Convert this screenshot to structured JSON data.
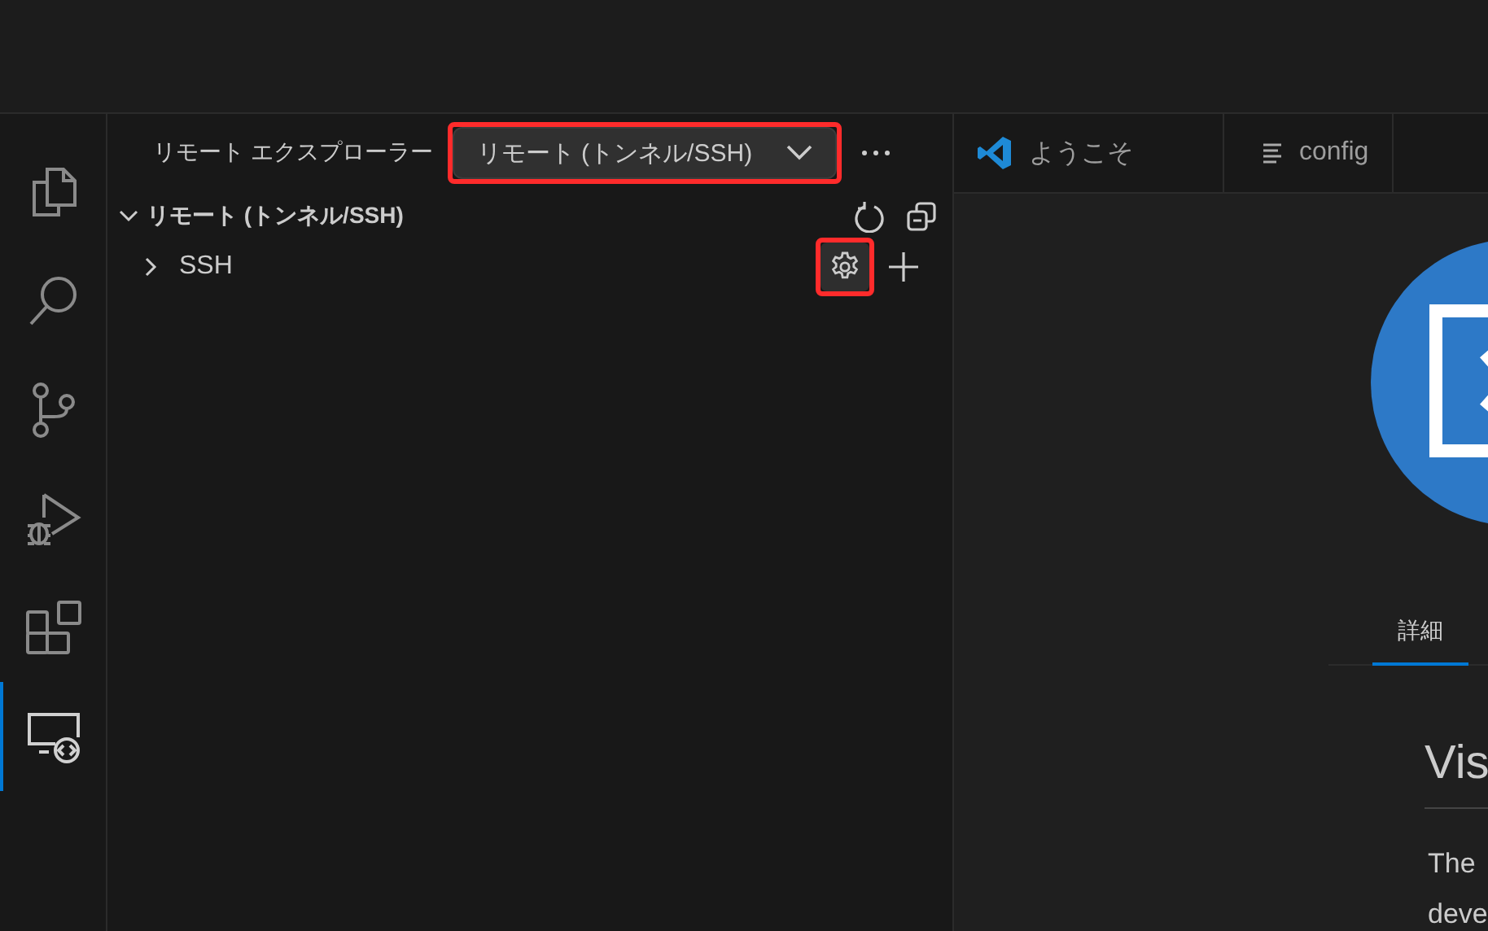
{
  "activity_bar": {
    "items": [
      {
        "kind": "files",
        "selected": false
      },
      {
        "kind": "search",
        "selected": false
      },
      {
        "kind": "branch",
        "selected": false
      },
      {
        "kind": "debug",
        "selected": false
      },
      {
        "kind": "blocks",
        "selected": false
      },
      {
        "kind": "remote",
        "selected": true
      }
    ]
  },
  "sidebar": {
    "title": "リモート エクスプローラー",
    "dropdown": {
      "value": "リモート (トンネル/SSH)",
      "highlighted": true
    },
    "section": {
      "title": "リモート (トンネル/SSH)",
      "expanded": true,
      "items": [
        {
          "label": "SSH",
          "expanded": false,
          "settings_highlighted": true
        }
      ]
    }
  },
  "editor": {
    "tabs": [
      {
        "label": "ようこそ",
        "kind": "welcome"
      },
      {
        "label": "config",
        "kind": "text"
      }
    ],
    "welcome": {
      "tabs": [
        {
          "label": "詳細",
          "selected": true
        }
      ],
      "heading": "Vis",
      "paragraph_lines": [
        "The",
        "deve"
      ]
    }
  }
}
